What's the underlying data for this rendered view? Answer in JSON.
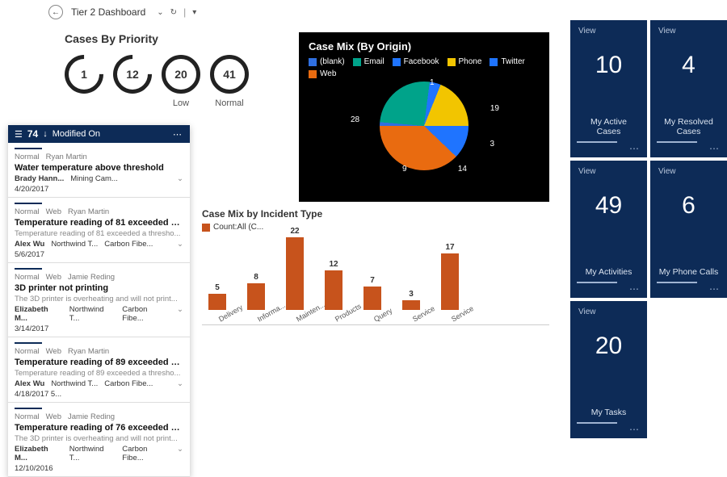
{
  "header": {
    "title": "Tier 2 Dashboard",
    "back_icon": "←"
  },
  "priority": {
    "title": "Cases By Priority",
    "items": [
      {
        "value": "1",
        "label": ""
      },
      {
        "value": "12",
        "label": ""
      },
      {
        "value": "20",
        "label": "Low"
      },
      {
        "value": "41",
        "label": "Normal"
      }
    ]
  },
  "pie": {
    "title": "Case Mix (By Origin)",
    "legend": [
      {
        "label": "(blank)",
        "color": "#2f6fe0"
      },
      {
        "label": "Email",
        "color": "#00a38a"
      },
      {
        "label": "Facebook",
        "color": "#1f74ff"
      },
      {
        "label": "Phone",
        "color": "#f2c500"
      },
      {
        "label": "Twitter",
        "color": "#1f74ff"
      },
      {
        "label": "Web",
        "color": "#e96b10"
      }
    ],
    "labels": {
      "blank": "1",
      "email": "19",
      "facebook": "3",
      "phone": "14",
      "twitter": "9",
      "web": "28"
    }
  },
  "bars": {
    "title": "Case Mix by Incident Type",
    "legend": "Count:All (C...",
    "items": [
      {
        "cat": "Delivery",
        "val": 5
      },
      {
        "cat": "Informa...",
        "val": 8
      },
      {
        "cat": "Mainten...",
        "val": 22
      },
      {
        "cat": "Products",
        "val": 12
      },
      {
        "cat": "Query",
        "val": 7
      },
      {
        "cat": "Service",
        "val": 3
      },
      {
        "cat": "Service",
        "val": 17
      }
    ]
  },
  "records": {
    "count": "74",
    "sort_label": "Modified On",
    "items": [
      {
        "priority": "Normal",
        "origin": "",
        "owner": "Ryan Martin",
        "title": "Water temperature above threshold",
        "desc": "",
        "contact": "Brady Hann...",
        "account": "Mining Cam...",
        "product": "",
        "date": "4/20/2017"
      },
      {
        "priority": "Normal",
        "origin": "Web",
        "owner": "Ryan Martin",
        "title": "Temperature reading of 81 exceeded a thresh...",
        "desc": "Temperature reading of 81 exceeded a thresho...",
        "contact": "Alex Wu",
        "account": "Northwind T...",
        "product": "Carbon Fibe...",
        "date": "5/6/2017"
      },
      {
        "priority": "Normal",
        "origin": "Web",
        "owner": "Jamie Reding",
        "title": "3D printer not printing",
        "desc": "The 3D printer is overheating and will not print...",
        "contact": "Elizabeth M...",
        "account": "Northwind T...",
        "product": "Carbon Fibe...",
        "date": "3/14/2017"
      },
      {
        "priority": "Normal",
        "origin": "Web",
        "owner": "Ryan Martin",
        "title": "Temperature reading of 89 exceeded a thresh...",
        "desc": "Temperature reading of 89 exceeded a thresho...",
        "contact": "Alex Wu",
        "account": "Northwind T...",
        "product": "Carbon Fibe...",
        "date": "4/18/2017 5..."
      },
      {
        "priority": "Normal",
        "origin": "Web",
        "owner": "Jamie Reding",
        "title": "Temperature reading of 76 exceeded a thresh...",
        "desc": "The 3D printer is overheating and will not print...",
        "contact": "Elizabeth M...",
        "account": "Northwind T...",
        "product": "Carbon Fibe...",
        "date": "12/10/2016"
      }
    ]
  },
  "tiles": [
    {
      "view": "View",
      "num": "10",
      "cap": "My Active Cases"
    },
    {
      "view": "View",
      "num": "4",
      "cap": "My Resolved Cases"
    },
    {
      "view": "View",
      "num": "49",
      "cap": "My Activities"
    },
    {
      "view": "View",
      "num": "6",
      "cap": "My Phone Calls"
    },
    {
      "view": "View",
      "num": "20",
      "cap": "My Tasks"
    }
  ],
  "chart_data": [
    {
      "type": "pie",
      "title": "Case Mix (By Origin)",
      "categories": [
        "(blank)",
        "Email",
        "Facebook",
        "Phone",
        "Twitter",
        "Web"
      ],
      "values": [
        1,
        19,
        3,
        14,
        9,
        28
      ],
      "colors": [
        "#2f6fe0",
        "#00a38a",
        "#1f74ff",
        "#f2c500",
        "#1f74ff",
        "#e96b10"
      ]
    },
    {
      "type": "bar",
      "title": "Case Mix by Incident Type",
      "categories": [
        "Delivery",
        "Information",
        "Maintenance",
        "Products",
        "Query",
        "Service",
        "Service"
      ],
      "values": [
        5,
        8,
        22,
        12,
        7,
        3,
        17
      ],
      "ylabel": "Count:All",
      "ylim": [
        0,
        25
      ]
    },
    {
      "type": "table",
      "title": "Cases By Priority",
      "categories": [
        "",
        "",
        "Low",
        "Normal"
      ],
      "values": [
        1,
        12,
        20,
        41
      ]
    }
  ]
}
